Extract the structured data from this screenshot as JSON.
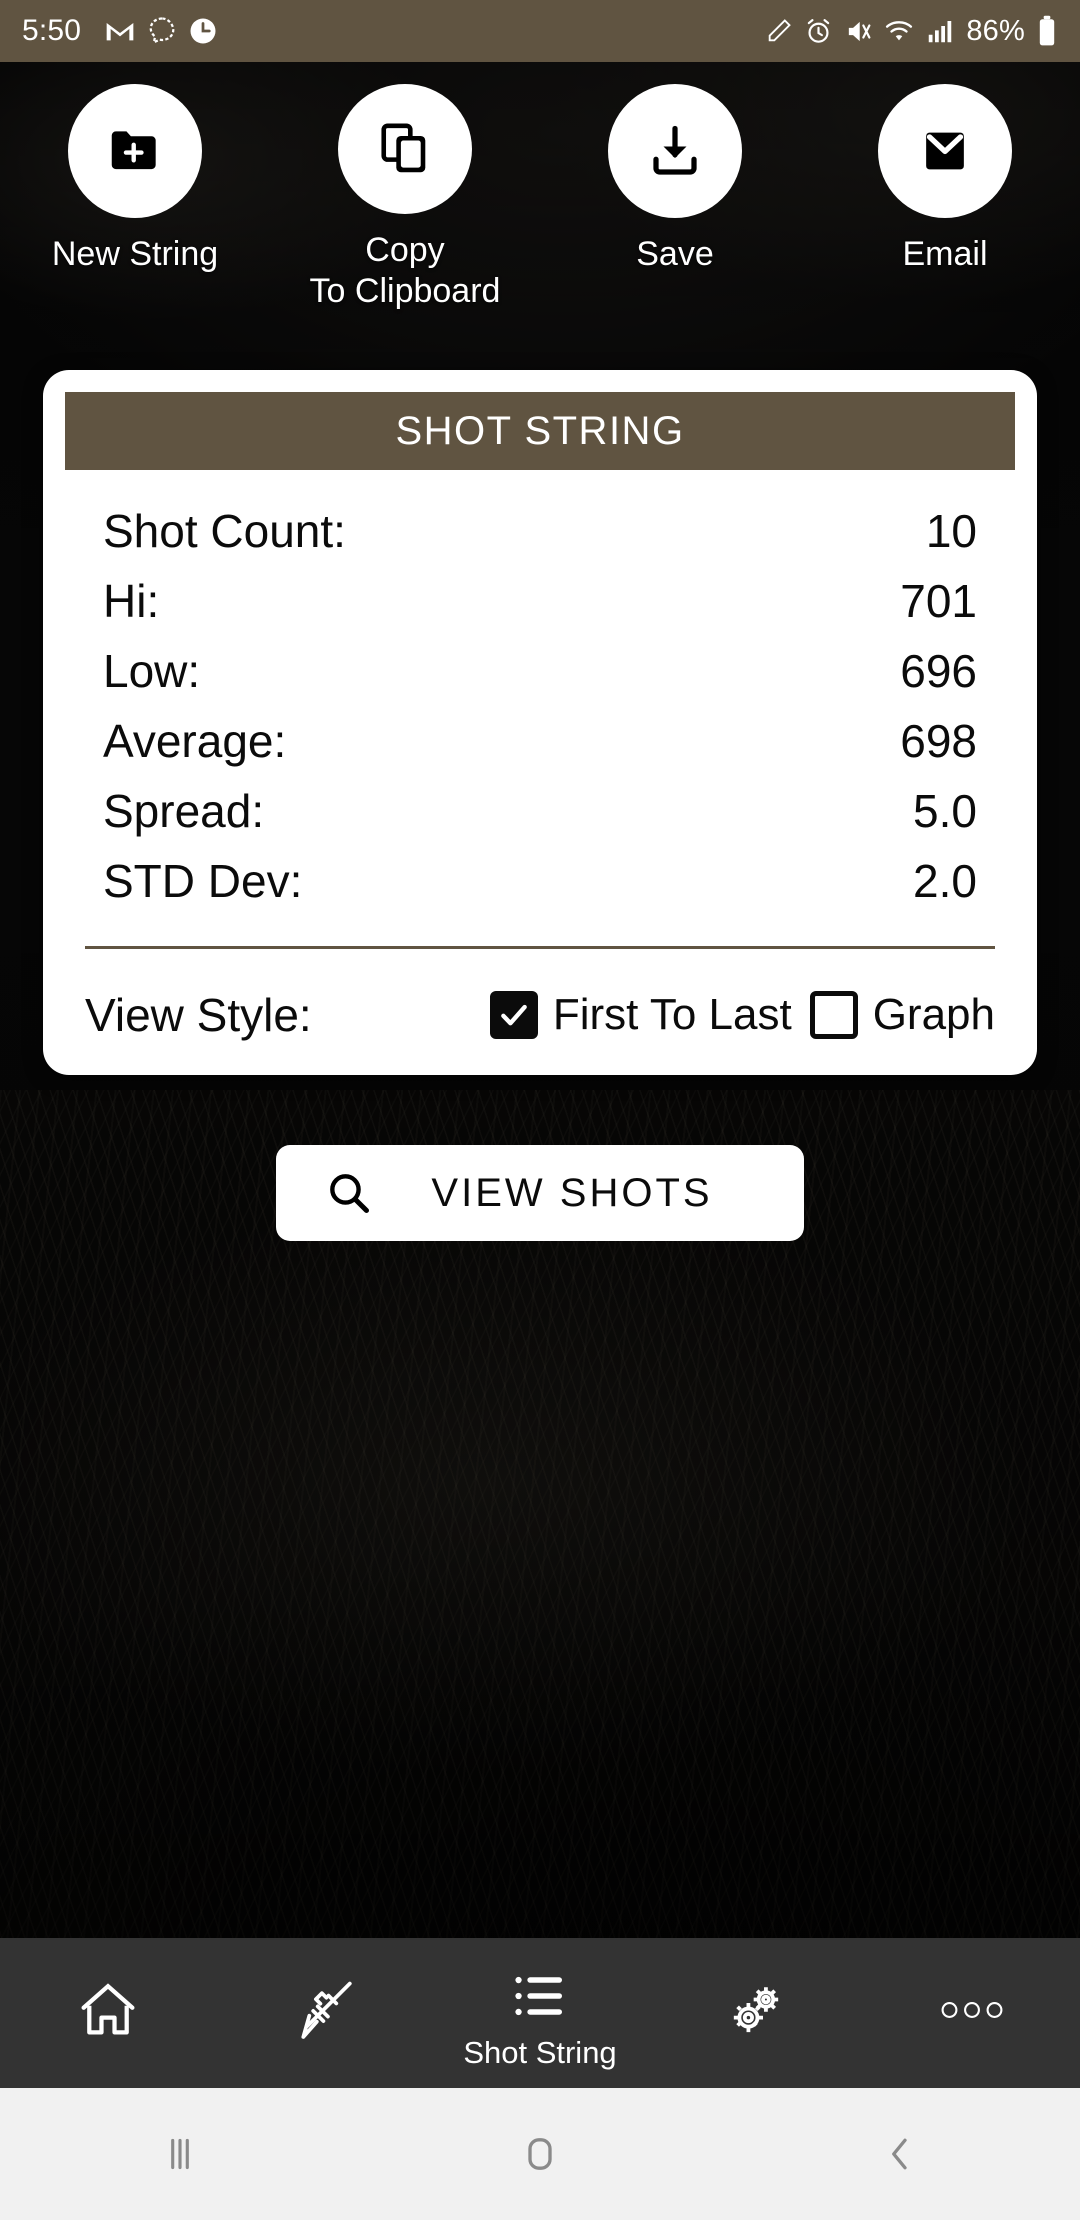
{
  "status_bar": {
    "time": "5:50",
    "battery_percent": "86%",
    "left_icons": [
      "gmail-icon",
      "signal-messenger-icon",
      "pocketcasts-icon"
    ],
    "right_icons": [
      "pencil-icon",
      "alarm-icon",
      "mute-vibrate-icon",
      "wifi-icon",
      "cellular-signal-icon"
    ]
  },
  "actions": [
    {
      "label": "New String",
      "icon": "new-folder-icon"
    },
    {
      "label": "Copy\nTo Clipboard",
      "icon": "copy-icon"
    },
    {
      "label": "Save",
      "icon": "download-save-icon"
    },
    {
      "label": "Email",
      "icon": "envelope-icon"
    }
  ],
  "card": {
    "header": "SHOT STRING",
    "stats": [
      {
        "label": "Shot Count:",
        "value": "10"
      },
      {
        "label": "Hi:",
        "value": "701"
      },
      {
        "label": "Low:",
        "value": "696"
      },
      {
        "label": "Average:",
        "value": "698"
      },
      {
        "label": "Spread:",
        "value": "5.0"
      },
      {
        "label": "STD Dev:",
        "value": "2.0"
      }
    ],
    "view_style": {
      "label": "View Style:",
      "options": [
        {
          "label": "First To Last",
          "checked": true
        },
        {
          "label": "Graph",
          "checked": false
        }
      ]
    }
  },
  "view_shots_button": {
    "label": "VIEW SHOTS",
    "icon": "search-icon"
  },
  "bottom_nav": [
    {
      "label": "",
      "icon": "home-icon",
      "active": false
    },
    {
      "label": "",
      "icon": "rifle-icon",
      "active": false
    },
    {
      "label": "Shot String",
      "icon": "list-icon",
      "active": true
    },
    {
      "label": "",
      "icon": "gears-icon",
      "active": false
    },
    {
      "label": "",
      "icon": "more-dots-icon",
      "active": false
    }
  ],
  "system_nav": [
    {
      "icon": "recents-icon"
    },
    {
      "icon": "home-square-icon"
    },
    {
      "icon": "back-chevron-icon"
    }
  ],
  "colors": {
    "accent_brown": "#605441",
    "card_background": "#ffffff",
    "nav_background": "#333333",
    "system_nav_background": "#f1f1f1"
  }
}
